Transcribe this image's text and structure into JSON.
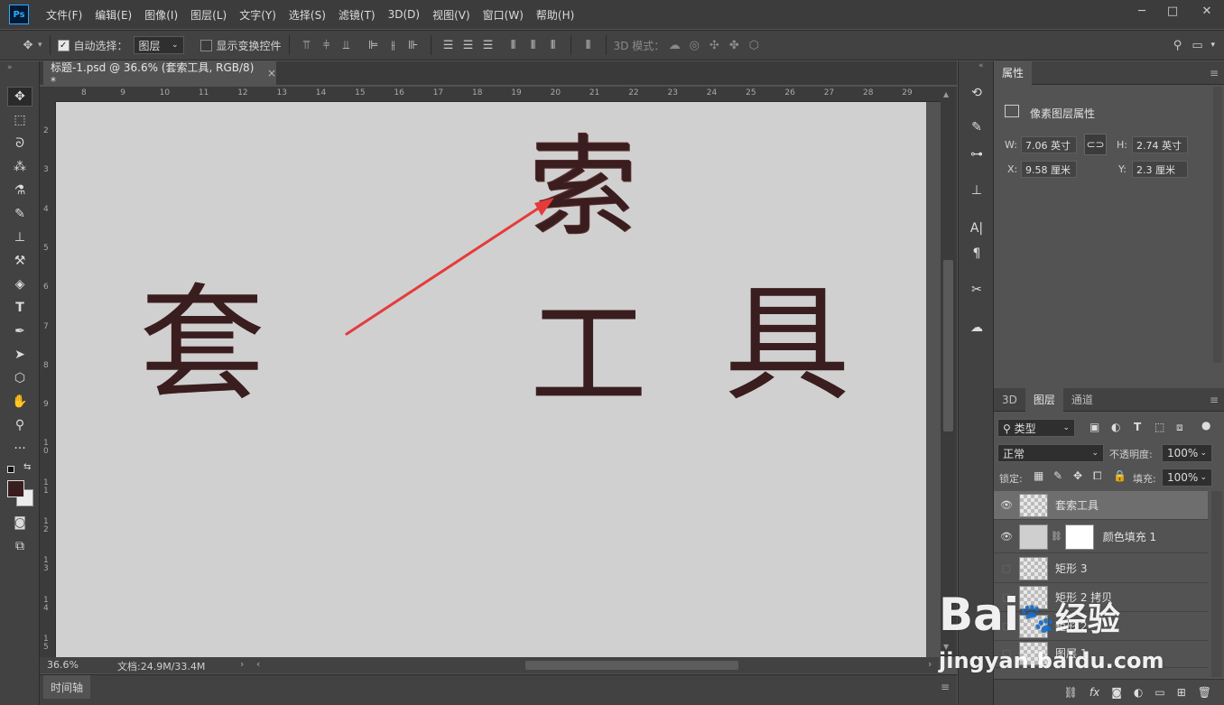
{
  "app": {
    "logo": "Ps"
  },
  "menubar": {
    "items": [
      "文件(F)",
      "编辑(E)",
      "图像(I)",
      "图层(L)",
      "文字(Y)",
      "选择(S)",
      "滤镜(T)",
      "3D(D)",
      "视图(V)",
      "窗口(W)",
      "帮助(H)"
    ]
  },
  "window_controls": {
    "minimize": "─",
    "restore": "□",
    "close": "✕"
  },
  "options": {
    "auto_select_label": "自动选择：",
    "auto_select_value": "图层",
    "show_transform_label": "显示变换控件",
    "mode_3d_label": "3D 模式："
  },
  "document": {
    "tab_title": "标题-1.psd @ 36.6% (套索工具, RGB/8) *",
    "close": "×",
    "chars": {
      "tao": "套",
      "suo": "索",
      "gong": "工",
      "ju": "具"
    },
    "zoom": "36.6%",
    "doc_size": "文档:24.9M/33.4M"
  },
  "rulers": {
    "h": [
      "8",
      "9",
      "10",
      "11",
      "12",
      "13",
      "14",
      "15",
      "16",
      "17",
      "18",
      "19",
      "20",
      "21",
      "22",
      "23",
      "24",
      "25",
      "26",
      "27",
      "28",
      "29"
    ],
    "v": [
      "2",
      "3",
      "4",
      "5",
      "6",
      "7",
      "8",
      "9",
      "1\n0",
      "1\n1",
      "1\n2",
      "1\n3",
      "1\n4",
      "1\n5"
    ]
  },
  "timeline": {
    "label": "时间轴"
  },
  "properties": {
    "tab": "属性",
    "title": "像素图层属性",
    "w_label": "W:",
    "w_value": "7.06 英寸",
    "h_label": "H:",
    "h_value": "2.74 英寸",
    "x_label": "X:",
    "x_value": "9.58 厘米",
    "y_label": "Y:",
    "y_value": "2.3 厘米"
  },
  "layers_panel": {
    "tabs": [
      "3D",
      "图层",
      "通道"
    ],
    "filter": "类型",
    "blend_mode": "正常",
    "opacity_label": "不透明度:",
    "opacity_value": "100%",
    "lock_label": "锁定:",
    "fill_label": "填充:",
    "fill_value": "100%",
    "layers": [
      {
        "name": "套索工具",
        "visible": true,
        "selected": true
      },
      {
        "name": "颜色填充 1",
        "visible": true,
        "selected": false
      },
      {
        "name": "矩形 3",
        "visible": false,
        "selected": false
      },
      {
        "name": "矩形 2 拷贝",
        "visible": false,
        "selected": false
      },
      {
        "name": "矩形 2",
        "visible": false,
        "selected": false
      },
      {
        "name": "图层 1",
        "visible": false,
        "selected": false
      }
    ],
    "footer_fx": "fx"
  },
  "watermark": {
    "brand": "Bai",
    "brand2": "经验",
    "url": "jingyan.baidu.com"
  },
  "colors": {
    "accent": "#31a8ff",
    "arrow": "#e63b3b",
    "glyph": "#3a1d1e",
    "canvas": "#d0d0d0"
  }
}
